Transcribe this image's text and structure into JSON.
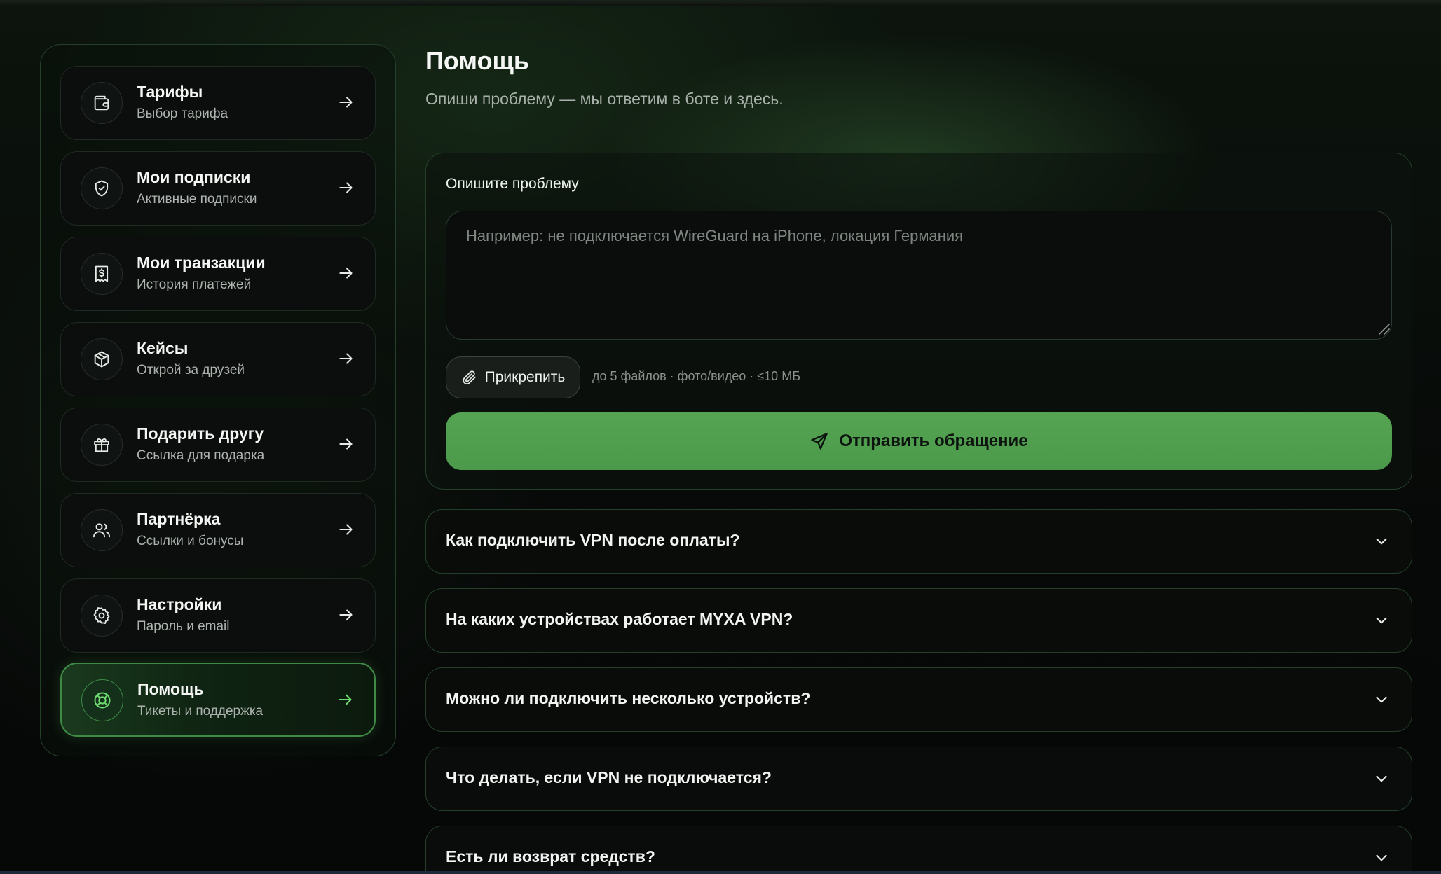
{
  "sidebar": {
    "items": [
      {
        "title": "Тарифы",
        "subtitle": "Выбор тарифа",
        "icon": "wallet-icon",
        "active": false
      },
      {
        "title": "Мои подписки",
        "subtitle": "Активные подписки",
        "icon": "shield-check-icon",
        "active": false
      },
      {
        "title": "Мои транзакции",
        "subtitle": "История платежей",
        "icon": "receipt-dollar-icon",
        "active": false
      },
      {
        "title": "Кейсы",
        "subtitle": "Открой за друзей",
        "icon": "box-icon",
        "active": false
      },
      {
        "title": "Подарить другу",
        "subtitle": "Ссылка для подарка",
        "icon": "gift-icon",
        "active": false
      },
      {
        "title": "Партнёрка",
        "subtitle": "Ссылки и бонусы",
        "icon": "users-icon",
        "active": false
      },
      {
        "title": "Настройки",
        "subtitle": "Пароль и email",
        "icon": "gear-icon",
        "active": false
      },
      {
        "title": "Помощь",
        "subtitle": "Тикеты и поддержка",
        "icon": "lifebuoy-icon",
        "active": true
      }
    ]
  },
  "main": {
    "title": "Помощь",
    "subtitle": "Опиши проблему — мы ответим в боте и здесь."
  },
  "form": {
    "label": "Опишите проблему",
    "placeholder": "Например: не подключается WireGuard на iPhone, локация Германия",
    "value": "",
    "attach_label": "Прикрепить",
    "attach_note": "до 5 файлов · фото/видео · ≤10 МБ",
    "submit_label": "Отправить обращение"
  },
  "faq": [
    {
      "question": "Как подключить VPN после оплаты?"
    },
    {
      "question": "На каких устройствах работает MYXA VPN?"
    },
    {
      "question": "Можно ли подключить несколько устройств?"
    },
    {
      "question": "Что делать, если VPN не подключается?"
    },
    {
      "question": "Есть ли возврат средств?"
    }
  ],
  "colors": {
    "accent": "#4fa04f",
    "active_icon": "#6fdc72",
    "border": "#24402a",
    "background": "#070908"
  }
}
